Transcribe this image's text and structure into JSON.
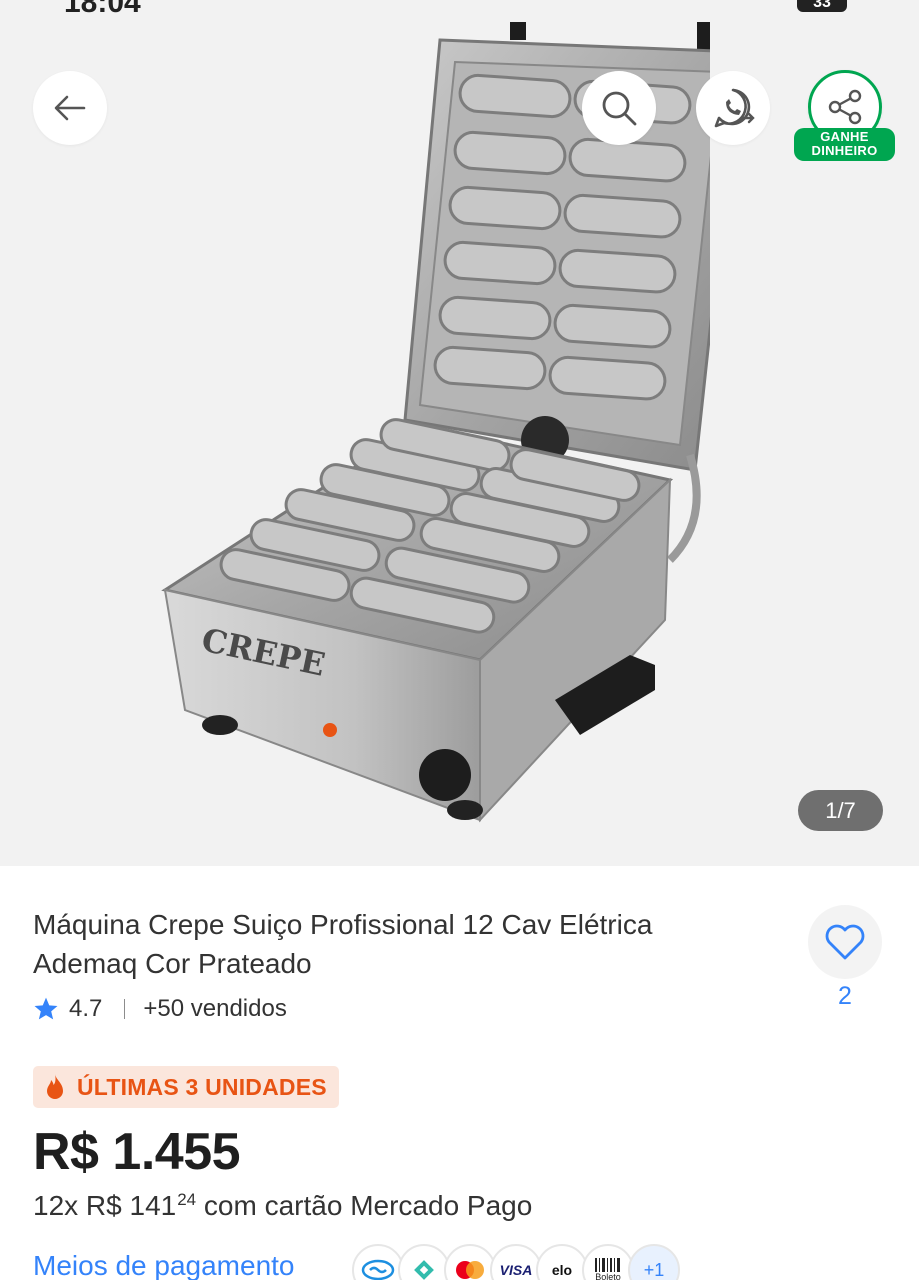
{
  "status_bar": {
    "time": "18:04",
    "battery": "33"
  },
  "gallery": {
    "page_counter": "1/7",
    "share_badge": "GANHE DINHEIRO",
    "image_brand": "CREPE"
  },
  "product": {
    "title": "Máquina Crepe Suiço Profissional 12 Cav Elétrica Ademaq Cor Prateado",
    "rating": "4.7",
    "sold": "+50 vendidos",
    "favorites_count": "2",
    "urgency": "ÚLTIMAS 3 UNIDADES",
    "price": "R$ 1.455",
    "installments_prefix": "12x R$ 141",
    "installments_cents": "24",
    "installments_suffix": "com cartão Mercado Pago",
    "payments_link": "Meios de pagamento"
  },
  "payment_methods": [
    "mercado-pago",
    "pix",
    "mastercard",
    "VISA",
    "elo",
    "Boleto",
    "+1"
  ],
  "colors": {
    "accent_blue": "#3483fa",
    "green": "#00a650",
    "urgency_orange": "#e85414",
    "urgency_bg": "#fbe6dc",
    "gallery_bg": "#f2f2f2"
  }
}
